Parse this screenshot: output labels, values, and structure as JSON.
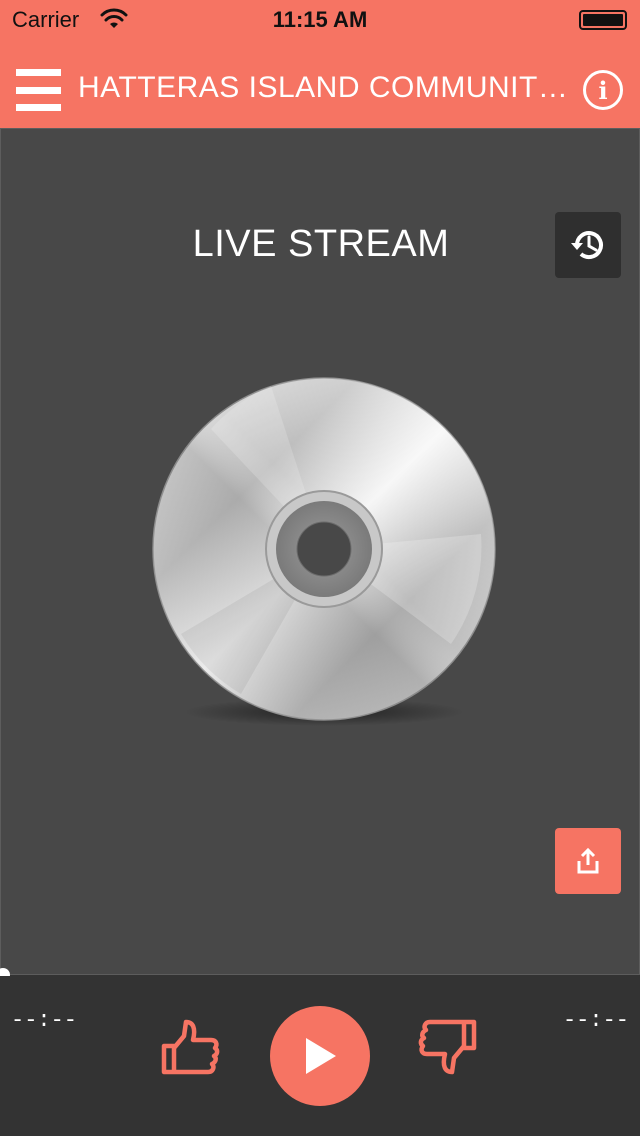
{
  "status_bar": {
    "carrier": "Carrier",
    "time": "11:15 AM",
    "wifi_icon": "wifi-icon",
    "battery_icon": "battery-icon",
    "battery_level": 1.0
  },
  "nav_bar": {
    "menu_icon": "hamburger-menu-icon",
    "title": "HATTERAS ISLAND COMMUNITY RADIO",
    "info_icon": "info-icon"
  },
  "player": {
    "stream_title": "LIVE STREAM",
    "history_icon": "history-icon",
    "artwork_icon": "cd-disc-icon",
    "share_icon": "share-icon",
    "progress": 0.0
  },
  "controls": {
    "elapsed": "--:--",
    "duration": "--:--",
    "like_icon": "thumbs-up-icon",
    "play_icon": "play-icon",
    "dislike_icon": "thumbs-down-icon"
  },
  "colors": {
    "accent": "#f67463",
    "panel": "#484848",
    "controls_bg": "#333333",
    "history_button_bg": "#2f2f2f"
  }
}
